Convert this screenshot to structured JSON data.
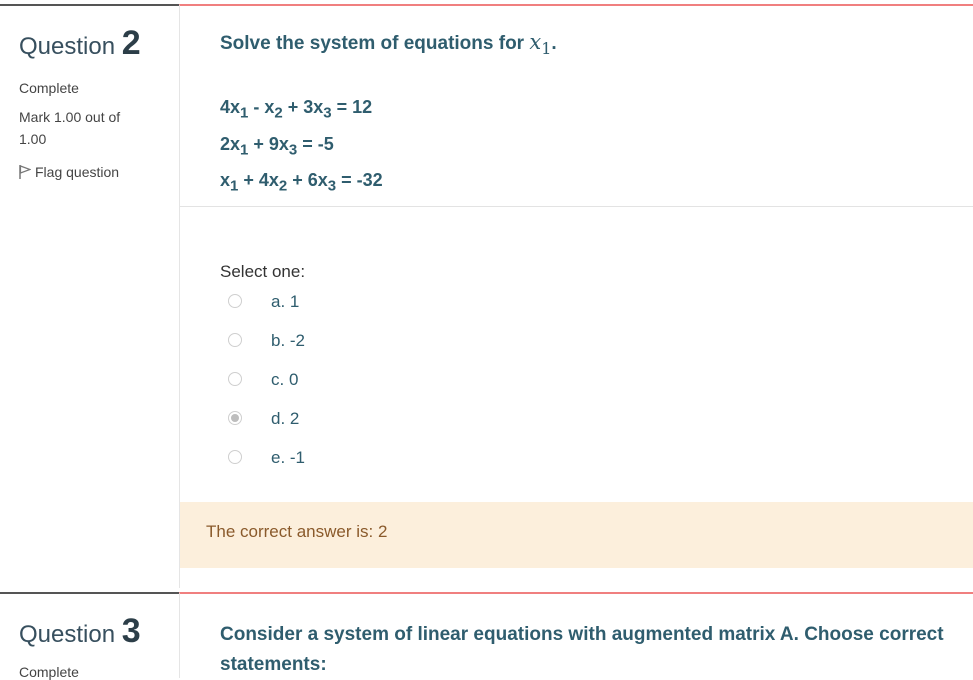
{
  "q2": {
    "title_prefix": "Question",
    "number": "2",
    "state": "Complete",
    "grade": "Mark 1.00 out of 1.00",
    "flag_label": "Flag question",
    "text": "Solve the system of equations for",
    "var": "x",
    "var_sub": "1",
    "period": ".",
    "equations": [
      {
        "a": "4x",
        "s1": "1",
        "b": " - x",
        "s2": "2",
        "c": " + 3x",
        "s3": "3",
        "rhs": " = 12"
      },
      {
        "a": "2x",
        "s1": "1",
        "b": " + 9x",
        "s2": "3",
        "c": "",
        "s3": "",
        "rhs": " = -5"
      },
      {
        "a": "x",
        "s1": "1",
        "b": " + 4x",
        "s2": "2",
        "c": " + 6x",
        "s3": "3",
        "rhs": " = -32"
      }
    ],
    "prompt": "Select one:",
    "options": [
      "a. 1",
      "b. -2",
      "c. 0",
      "d. 2",
      "e. -1"
    ],
    "selected_option_index": 3,
    "feedback": "The correct answer is: 2"
  },
  "q3": {
    "title_prefix": "Question",
    "number": "3",
    "state": "Complete",
    "text": "Consider a system of linear equations with augmented matrix A. Choose correct statements:"
  },
  "colors": {
    "content_top_border": "#f07f7f",
    "question_text": "#2f5d6e",
    "feedback_bg": "#fcefdc"
  }
}
